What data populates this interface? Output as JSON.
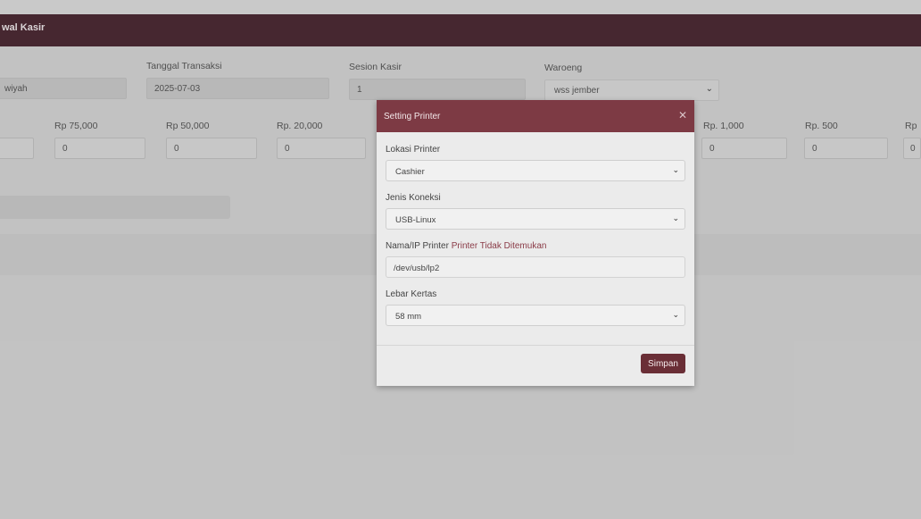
{
  "header": {
    "title": "wal Kasir"
  },
  "form": {
    "field1_value": "wiyah",
    "tanggal_label": "Tanggal Transaksi",
    "tanggal_value": "2025-07-03",
    "sesion_label": "Sesion Kasir",
    "sesion_value": "1",
    "waroeng_label": "Waroeng",
    "waroeng_value": "wss jember"
  },
  "denominations": [
    {
      "label": "Rp 75,000",
      "value": "0"
    },
    {
      "label": "Rp 50,000",
      "value": "0"
    },
    {
      "label": "Rp. 20,000",
      "value": "0"
    },
    {
      "label": "Rp. 1,000",
      "value": "0"
    },
    {
      "label": "Rp. 500",
      "value": "0"
    },
    {
      "label": "Rp",
      "value": "0"
    }
  ],
  "modal": {
    "title": "Setting Printer",
    "close_icon": "close-icon",
    "lokasi_label": "Lokasi Printer",
    "lokasi_value": "Cashier",
    "koneksi_label": "Jenis Koneksi",
    "koneksi_value": "USB-Linux",
    "nama_label": "Nama/IP Printer",
    "nama_warning": "Printer Tidak Ditemukan",
    "nama_value": "/dev/usb/lp2",
    "lebar_label": "Lebar Kertas",
    "lebar_value": "58 mm",
    "save_label": "Simpan",
    "warning_color": "#8a3b47",
    "accent": "#7d3a44"
  }
}
